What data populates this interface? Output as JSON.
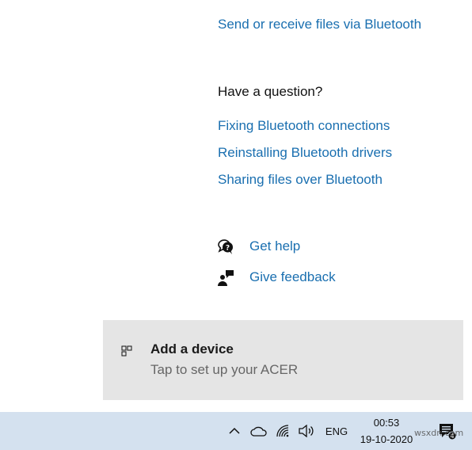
{
  "links": {
    "send_receive": "Send or receive files via Bluetooth"
  },
  "question": {
    "heading": "Have a question?",
    "items": [
      "Fixing Bluetooth connections",
      "Reinstalling Bluetooth drivers",
      "Sharing files over Bluetooth"
    ]
  },
  "help": {
    "get_help": "Get help",
    "give_feedback": "Give feedback"
  },
  "toast": {
    "icon": "add-device-icon",
    "title": "Add a device",
    "subtitle": "Tap to set up your ACER"
  },
  "taskbar": {
    "icons": [
      "chevron-up-icon",
      "cloud-icon",
      "wifi-icon",
      "volume-icon",
      "action-center-icon"
    ],
    "language": "ENG",
    "time": "00:53",
    "date": "19-10-2020",
    "notification_count": "4",
    "watermark": "wsxdn.com"
  },
  "colors": {
    "link": "#1a6fb0",
    "toast_bg": "#e5e5e5",
    "taskbar_bg": "#d4e1ef"
  }
}
